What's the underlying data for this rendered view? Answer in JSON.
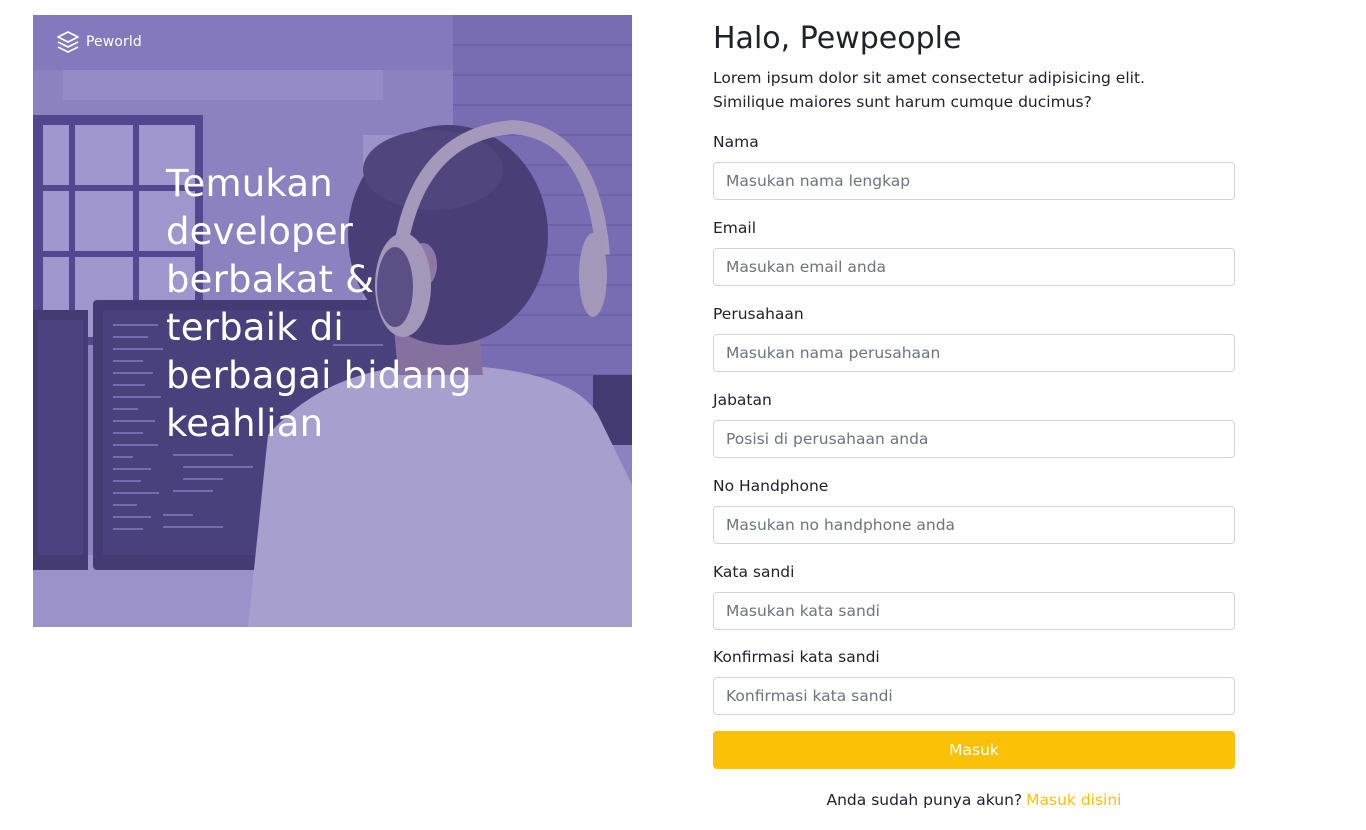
{
  "hero": {
    "brand_name": "Peworld",
    "headline": "Temukan developer berbakat & terbaik di berbagai bidang keahlian"
  },
  "form": {
    "title": "Halo, Pewpeople",
    "subtitle": "Lorem ipsum dolor sit amet consectetur adipisicing elit. Similique maiores sunt harum cumque ducimus?",
    "fields": [
      {
        "label": "Nama",
        "placeholder": "Masukan nama lengkap",
        "value": ""
      },
      {
        "label": "Email",
        "placeholder": "Masukan email anda",
        "value": ""
      },
      {
        "label": "Perusahaan",
        "placeholder": "Masukan nama perusahaan",
        "value": ""
      },
      {
        "label": "Jabatan",
        "placeholder": "Posisi di perusahaan anda",
        "value": ""
      },
      {
        "label": "No Handphone",
        "placeholder": "Masukan no handphone anda",
        "value": ""
      },
      {
        "label": "Kata sandi",
        "placeholder": "Masukan kata sandi",
        "value": ""
      },
      {
        "label": "Konfirmasi kata sandi",
        "placeholder": "Konfirmasi kata sandi",
        "value": ""
      }
    ],
    "submit_label": "Masuk",
    "login_prompt": "Anda sudah punya akun?",
    "login_link": "Masuk disini"
  },
  "colors": {
    "accent": "#fbc107",
    "hero_tint": "#8f86c4"
  }
}
